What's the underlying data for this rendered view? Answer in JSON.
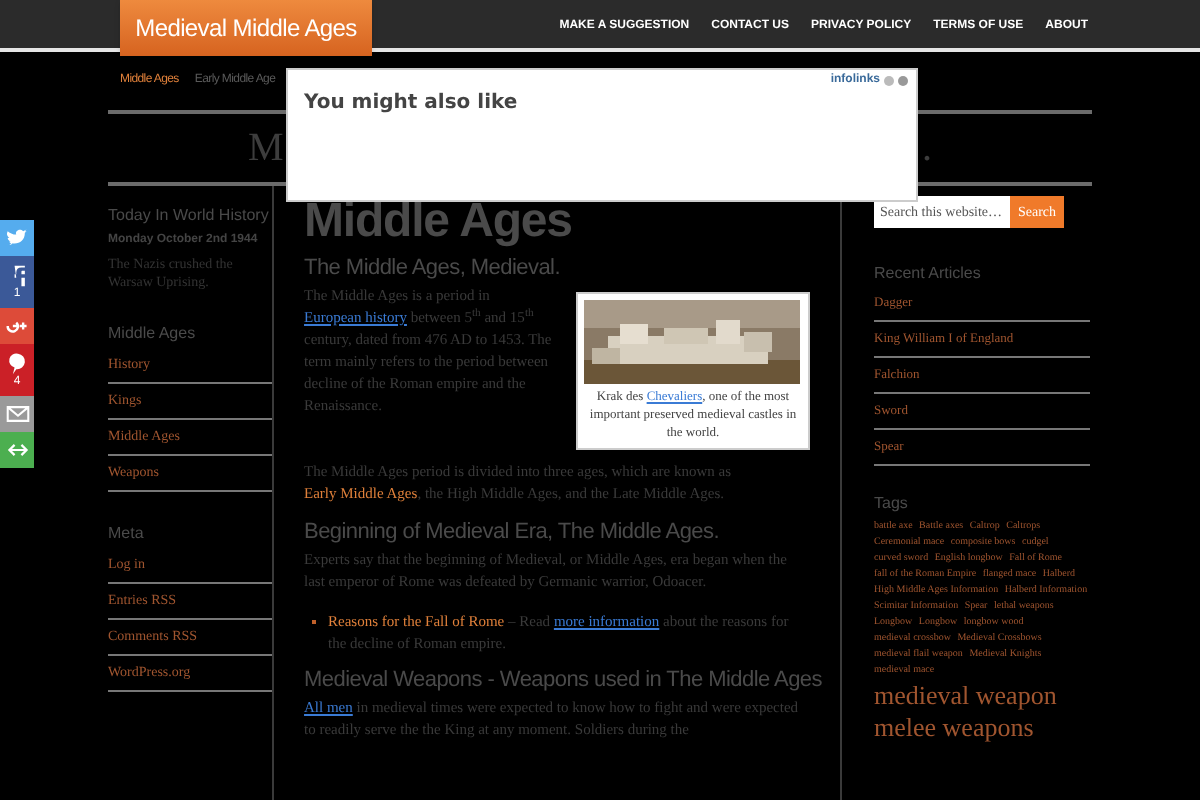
{
  "header": {
    "logo": "Medieval Middle Ages",
    "nav": [
      "MAKE A SUGGESTION",
      "CONTACT US",
      "PRIVACY POLICY",
      "TERMS OF USE",
      "ABOUT"
    ]
  },
  "subnav": [
    {
      "label": "Middle Ages",
      "selected": true
    },
    {
      "label": "Early Middle Age",
      "selected": false
    }
  ],
  "banner": {
    "left": "M",
    "right": "."
  },
  "popup": {
    "title": "You might also like",
    "brand": "infolinks"
  },
  "social": [
    {
      "kind": "twitter",
      "color": "#55acee"
    },
    {
      "kind": "facebook",
      "color": "#3b5998",
      "count": "1"
    },
    {
      "kind": "googleplus",
      "color": "#dd4b39"
    },
    {
      "kind": "pinterest",
      "color": "#cb2027",
      "count": "4"
    },
    {
      "kind": "email",
      "color": "#9a9a9a"
    },
    {
      "kind": "share",
      "color": "#4caf50"
    }
  ],
  "left_sidebar": {
    "today": {
      "title": "Today In World History",
      "date": "Monday October 2nd 1944",
      "text": "The Nazis crushed the Warsaw Uprising."
    },
    "sections": [
      {
        "title": "Middle Ages",
        "links": [
          "History",
          "Kings",
          "Middle Ages",
          "Weapons"
        ]
      },
      {
        "title": "Meta",
        "links": [
          "Log in",
          "Entries RSS",
          "Comments RSS",
          "WordPress.org"
        ]
      }
    ]
  },
  "content": [
    {
      "kind": "h1",
      "text": "Middle Ages"
    },
    {
      "kind": "h2",
      "text": "The Middle Ages, Medieval."
    },
    {
      "kind": "figure",
      "caption": [
        {
          "kind": "text",
          "text": "Krak des "
        },
        {
          "kind": "link",
          "text": "Chevaliers"
        },
        {
          "kind": "text",
          "text": ", one of the most important preserved medieval castles in the world."
        }
      ]
    },
    {
      "kind": "p",
      "parts": [
        {
          "kind": "text",
          "text": "The Middle Ages is a period in "
        },
        {
          "kind": "link",
          "text": "European history"
        },
        {
          "kind": "text",
          "text": " between 5$^{th}$ and 15$^{th}$ century, dated from 476 AD to 1453. The term mainly refers to the period between decline of the Roman empire and the Renaissance."
        }
      ]
    },
    {
      "kind": "p",
      "parts": [
        {
          "kind": "text",
          "text": "The Middle Ages period is divided into three ages, which are known as "
        },
        {
          "kind": "accent",
          "text": "Early Middle Ages"
        },
        {
          "kind": "text",
          "text": ", the High Middle Ages, and the Late Middle Ages."
        }
      ]
    },
    {
      "kind": "h2",
      "text": "Beginning of Medieval Era, The Middle Ages."
    },
    {
      "kind": "p",
      "parts": [
        {
          "kind": "text",
          "text": "Experts say that the beginning of Medieval, or Middle Ages, era began when the last emperor of Rome was defeated by Germanic warrior, Odoacer."
        }
      ]
    },
    {
      "kind": "li",
      "parts": [
        {
          "kind": "accent",
          "text": "Reasons for the Fall of Rome"
        },
        {
          "kind": "text",
          "text": " – Read "
        },
        {
          "kind": "link",
          "text": "more information"
        },
        {
          "kind": "text",
          "text": " about the reasons for the decline of Roman empire."
        }
      ]
    },
    {
      "kind": "h2",
      "text": "Medieval Weapons - Weapons used in The Middle Ages"
    },
    {
      "kind": "p",
      "parts": [
        {
          "kind": "link",
          "text": "All men"
        },
        {
          "kind": "text",
          "text": " in medieval times were expected to know how to fight and were expected to readily serve the the King at any moment. Soldiers during the"
        }
      ]
    }
  ],
  "right_sidebar": {
    "search": {
      "placeholder": "Search this website…",
      "button": "Search"
    },
    "recent": {
      "title": "Recent Articles",
      "links": [
        "Dagger",
        "King William I of England",
        "Falchion",
        "Sword",
        "Spear"
      ]
    },
    "tags": {
      "title": "Tags",
      "items": [
        {
          "text": "battle axe",
          "kind": "small"
        },
        {
          "text": "Battle axes",
          "kind": "small"
        },
        {
          "text": "Caltrop",
          "kind": "small"
        },
        {
          "text": "Caltrops",
          "kind": "small"
        },
        {
          "text": "Ceremonial mace",
          "kind": "small"
        },
        {
          "text": "composite bows",
          "kind": "small"
        },
        {
          "text": "cudgel",
          "kind": "small"
        },
        {
          "text": "curved sword",
          "kind": "small"
        },
        {
          "text": "English longbow",
          "kind": "small"
        },
        {
          "text": "Fall of Rome",
          "kind": "small"
        },
        {
          "text": "fall of the Roman Empire",
          "kind": "small"
        },
        {
          "text": "flanged mace",
          "kind": "small"
        },
        {
          "text": "Halberd",
          "kind": "small"
        },
        {
          "text": "High Middle Ages Information",
          "kind": "small"
        },
        {
          "text": "Halberd Information",
          "kind": "small"
        },
        {
          "text": "Scimitar Information",
          "kind": "small"
        },
        {
          "text": "Spear",
          "kind": "small"
        },
        {
          "text": "lethal weapons",
          "kind": "small"
        },
        {
          "text": "Longbow",
          "kind": "small"
        },
        {
          "text": "Longbow",
          "kind": "small"
        },
        {
          "text": "longbow wood",
          "kind": "small"
        },
        {
          "text": "medieval crossbow",
          "kind": "small"
        },
        {
          "text": "Medieval Crossbows",
          "kind": "small"
        },
        {
          "text": "medieval flail weapon",
          "kind": "small"
        },
        {
          "text": "Medieval Knights",
          "kind": "small"
        },
        {
          "text": "medieval mace",
          "kind": "small"
        },
        {
          "text": "medieval weapon",
          "kind": "large"
        },
        {
          "text": "melee weapons",
          "kind": "large"
        }
      ]
    }
  }
}
